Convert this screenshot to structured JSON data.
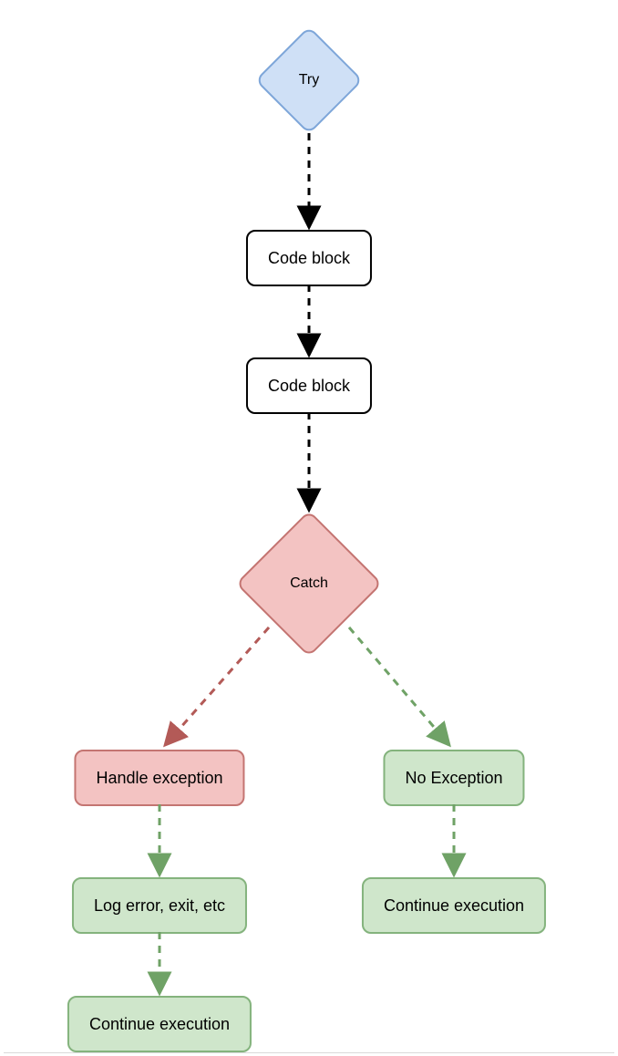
{
  "nodes": {
    "try": {
      "label": "Try"
    },
    "code1": {
      "label": "Code block"
    },
    "code2": {
      "label": "Code block"
    },
    "catch": {
      "label": "Catch"
    },
    "handle": {
      "label": "Handle exception"
    },
    "noexc": {
      "label": "No Exception"
    },
    "log": {
      "label": "Log error, exit, etc"
    },
    "cont_right": {
      "label": "Continue execution"
    },
    "cont_left": {
      "label": "Continue execution"
    }
  },
  "colors": {
    "try_fill": "#cfe0f6",
    "catch_fill": "#f3c3c2",
    "green_fill": "#cfe6cb",
    "arrow_black": "#000000",
    "arrow_red": "#b35a57",
    "arrow_green": "#6fa266"
  }
}
